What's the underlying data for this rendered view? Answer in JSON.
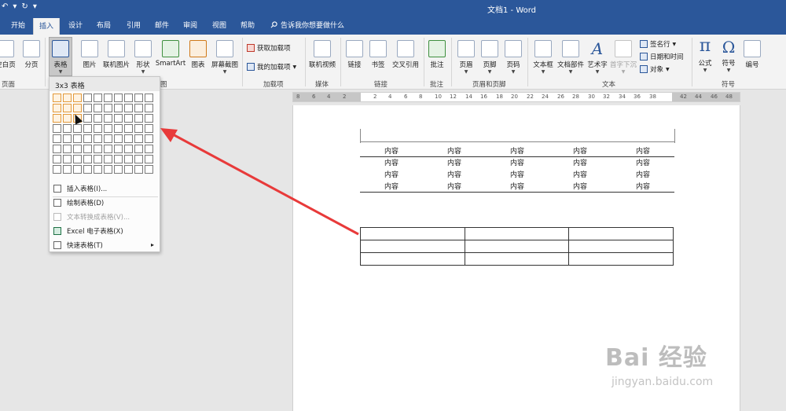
{
  "window": {
    "title": "文档1  -  Word"
  },
  "qat": {
    "undo": "↶",
    "undo_arrow": "▾",
    "redo": "↻",
    "customize": "▾"
  },
  "tabs": [
    {
      "label": "开始"
    },
    {
      "label": "插入"
    },
    {
      "label": "设计"
    },
    {
      "label": "布局"
    },
    {
      "label": "引用"
    },
    {
      "label": "邮件"
    },
    {
      "label": "审阅"
    },
    {
      "label": "视图"
    },
    {
      "label": "帮助"
    }
  ],
  "tell_me": {
    "placeholder": "告诉我你想要做什么"
  },
  "ribbon": {
    "blank_page": "空白页",
    "page_break": "分页",
    "table": "表格",
    "picture": "图片",
    "online_picture": "联机图片",
    "shapes": "形状",
    "smartart": "SmartArt",
    "chart": "图表",
    "screenshot": "屏幕截图",
    "get_addins": "获取加载项",
    "my_addins": "我的加载项",
    "online_video": "联机视频",
    "link": "链接",
    "bookmark": "书签",
    "cross_reference": "交叉引用",
    "comment": "批注",
    "header": "页眉",
    "footer": "页脚",
    "page_number": "页码",
    "textbox": "文本框",
    "quick_parts": "文档部件",
    "wordart": "艺术字",
    "dropcap": "首字下沉",
    "signature_line": "签名行",
    "date_time": "日期和时间",
    "object": "对象",
    "equation": "公式",
    "symbol": "符号",
    "number": "编号"
  },
  "groups": {
    "pages": "页面",
    "illustrations": "图",
    "addins": "加载项",
    "media": "媒体",
    "links": "链接",
    "comments": "批注",
    "header_footer": "页眉和页脚",
    "text": "文本",
    "symbols": "符号"
  },
  "ruler": {
    "ticks": [
      "8",
      "6",
      "4",
      "2",
      "",
      "2",
      "4",
      "6",
      "8",
      "10",
      "12",
      "14",
      "16",
      "18",
      "20",
      "22",
      "24",
      "26",
      "28",
      "30",
      "32",
      "34",
      "36",
      "38",
      "",
      "42",
      "44",
      "46",
      "48"
    ]
  },
  "table_dropdown": {
    "header": "3x3 表格",
    "grid": {
      "cols": 10,
      "rows": 8,
      "selected_cols": 3,
      "selected_rows": 3
    },
    "items": [
      {
        "label": "插入表格(I)...",
        "enabled": true
      },
      {
        "label": "绘制表格(D)",
        "enabled": true
      },
      {
        "label": "文本转换成表格(V)...",
        "enabled": false
      },
      {
        "label": "Excel 电子表格(X)",
        "enabled": true
      },
      {
        "label": "快速表格(T)",
        "enabled": true,
        "submenu_arrow": "▸"
      }
    ]
  },
  "document": {
    "table_rows": [
      [
        "内容",
        "内容",
        "内容",
        "内容",
        "内容"
      ],
      [
        "内容",
        "内容",
        "内容",
        "内容",
        "内容"
      ],
      [
        "内容",
        "内容",
        "内容",
        "内容",
        "内容"
      ],
      [
        "内容",
        "内容",
        "内容",
        "内容",
        "内容"
      ]
    ]
  },
  "watermark": {
    "brand": "Bai 经验",
    "url": "jingyan.baidu.com"
  },
  "colors": {
    "accent": "#2b579a",
    "highlight": "#e39a3a",
    "annotation_arrow": "#e83a3a"
  }
}
